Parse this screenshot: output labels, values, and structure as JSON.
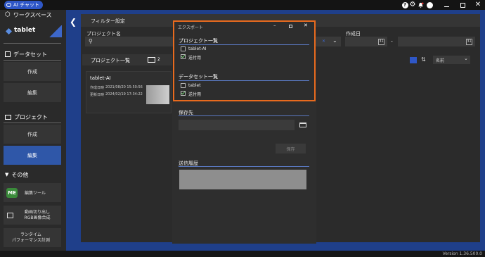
{
  "topbar": {
    "ai_chat_label": "AI チャット",
    "icons": [
      "help-icon",
      "gear-icon",
      "notification-icon",
      "user-icon",
      "minimize-icon",
      "maximize-icon",
      "close-icon"
    ]
  },
  "sidebar": {
    "workspace_label": "ワークスペース",
    "workspace_name": "tablet",
    "dataset_label": "データセット",
    "dataset_items": [
      "作成",
      "編集"
    ],
    "project_label": "プロジェクト",
    "project_items": [
      "作成",
      "編集"
    ],
    "other_label": "その他",
    "tools": [
      {
        "label": "編集ツール",
        "icon": "ME"
      },
      {
        "label": "動画切り出し\nRGB画像合成",
        "icon": "image-icon"
      },
      {
        "label": "ランタイム\nパフォーマンス計測",
        "icon": ""
      }
    ]
  },
  "filter": {
    "title": "フィルター設定",
    "project_name_label": "プロジェクト名",
    "created_date_label": "作成日",
    "date_separator": "-"
  },
  "project_list": {
    "title": "プロジェクト一覧",
    "count": "2",
    "sort_label": "名前",
    "card": {
      "name": "tablet-AI",
      "created_label": "作成日時",
      "created_value": "2021/08/20 15:50:56",
      "updated_label": "更新日時",
      "updated_value": "2024/02/19 17:34:22"
    }
  },
  "export_dialog": {
    "title": "エクスポート",
    "project_section": "プロジェクト一覧",
    "project_items": [
      {
        "label": "tablet-AI",
        "checked": false
      },
      {
        "label": "送付用",
        "checked": true
      }
    ],
    "dataset_section": "データセット一覧",
    "dataset_items": [
      {
        "label": "tablet",
        "checked": false
      },
      {
        "label": "送付用",
        "checked": true
      }
    ]
  },
  "save": {
    "label": "保存先",
    "path_value": "",
    "save_button": "保存",
    "history_label": "送信履歴"
  },
  "status": {
    "version": "Version 1.36.500.0"
  },
  "colors": {
    "accent": "#2f57c7",
    "frame": "#1f3f8a",
    "dialog_border": "#e86a1e",
    "check": "#7cd27c"
  }
}
